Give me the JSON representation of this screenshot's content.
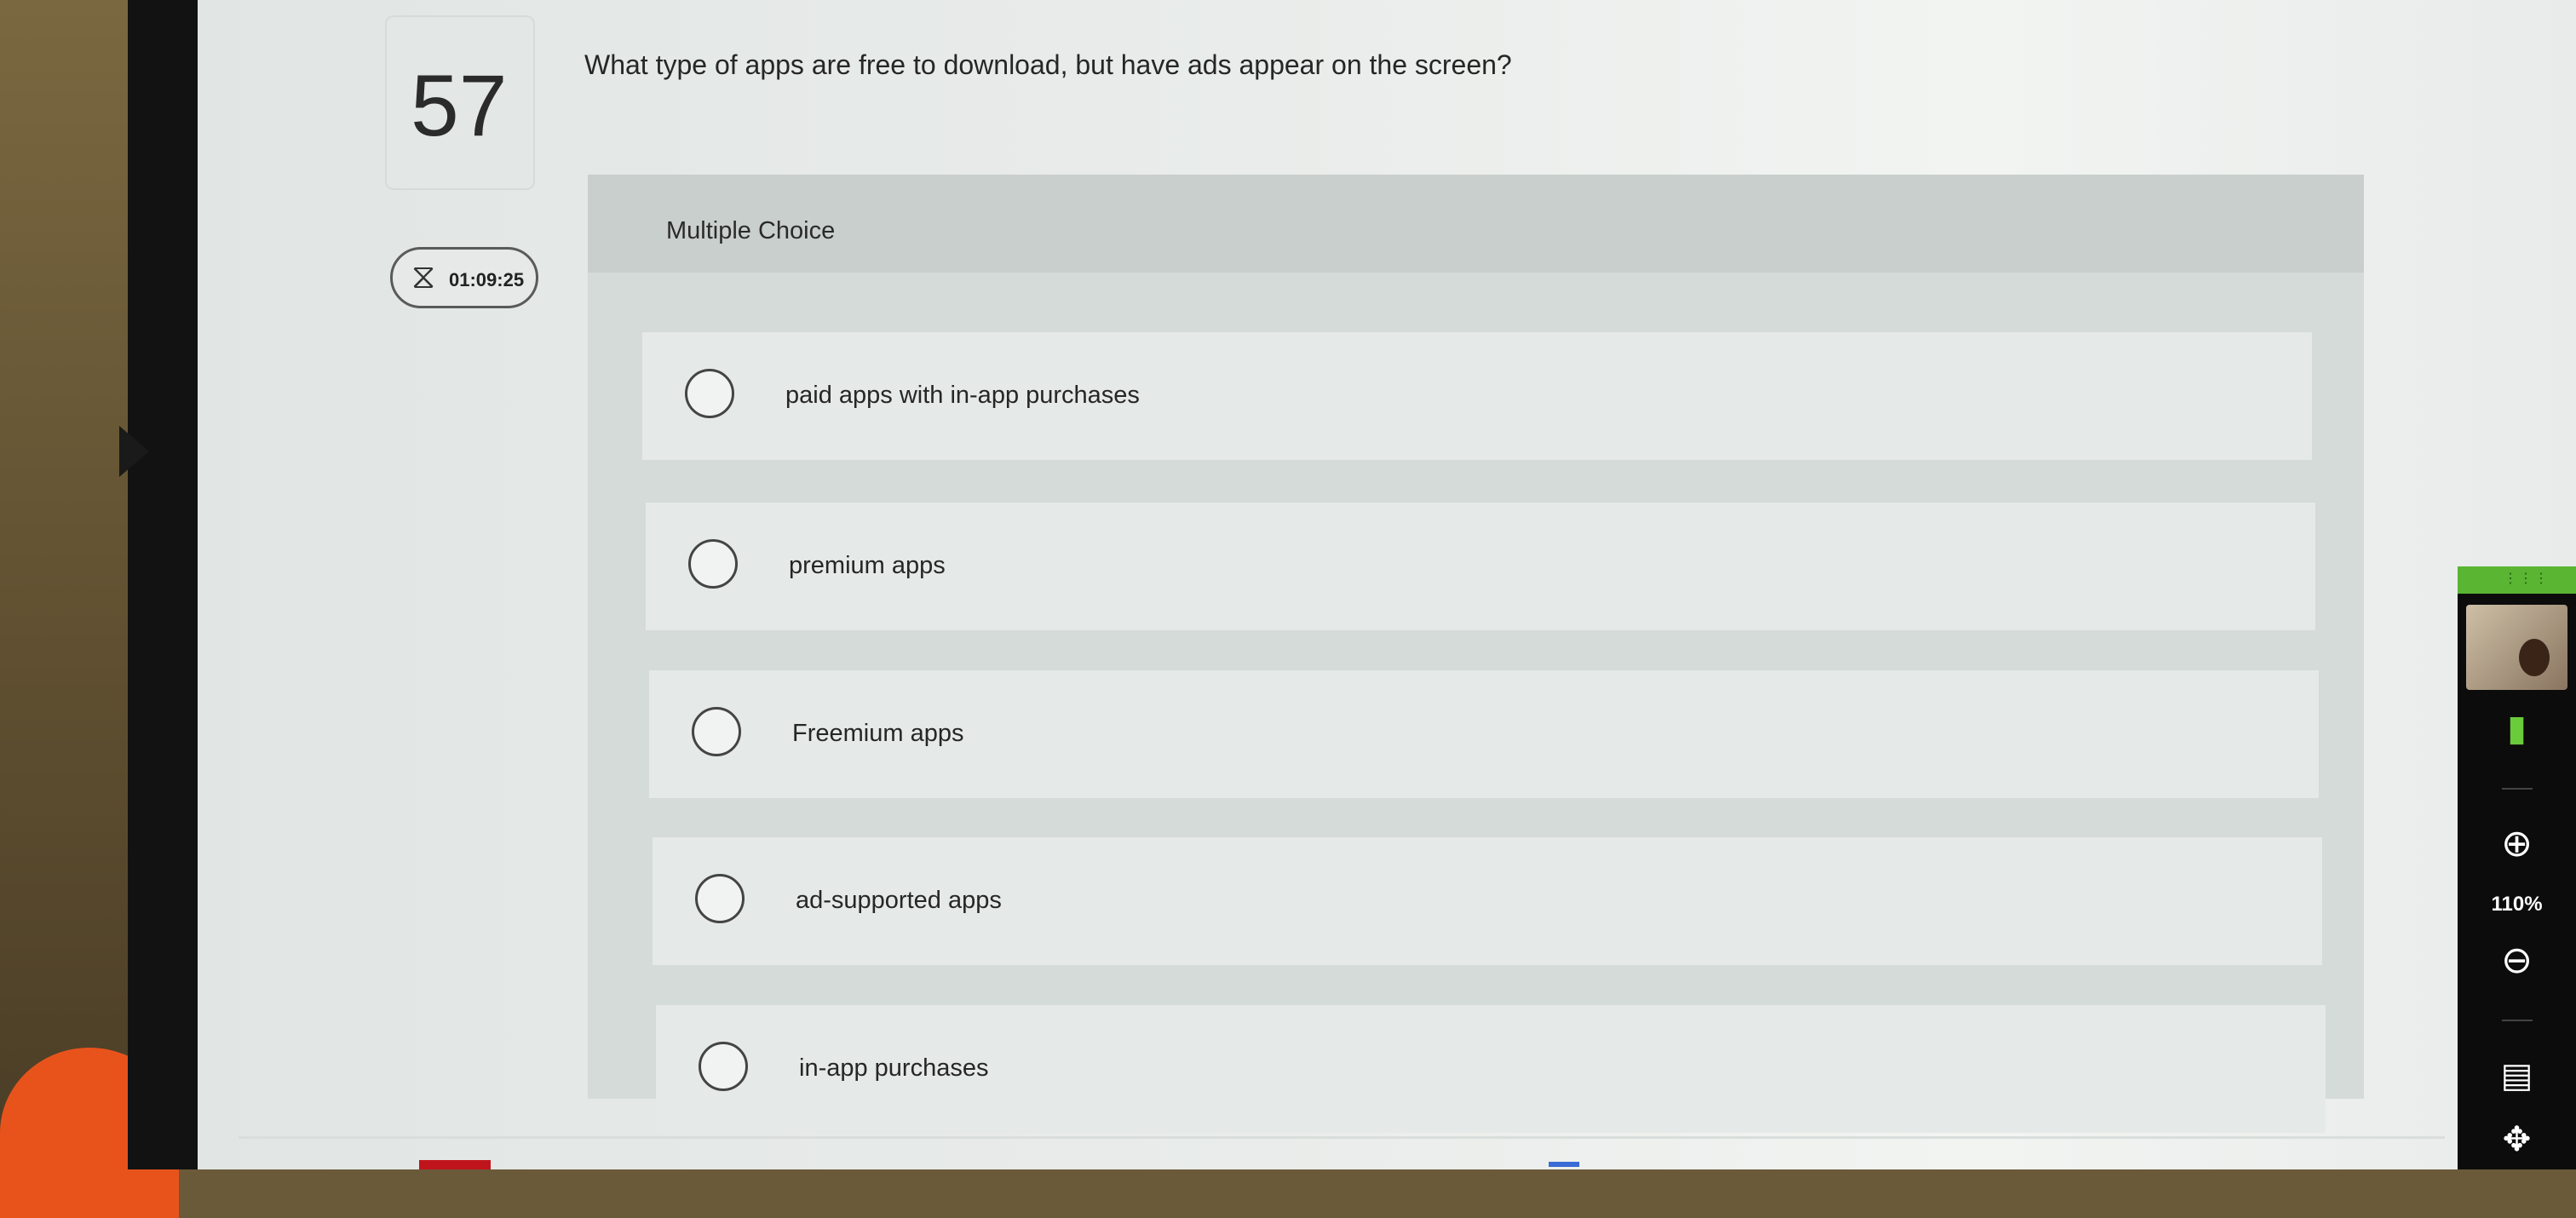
{
  "question": {
    "number": "57",
    "text": "What type of apps are free to download, but have ads appear on the screen?",
    "timer": "01:09:25",
    "type_label": "Multiple Choice"
  },
  "options": [
    {
      "label": "paid apps with in-app purchases"
    },
    {
      "label": "premium apps"
    },
    {
      "label": "Freemium apps"
    },
    {
      "label": "ad-supported apps"
    },
    {
      "label": "in-app purchases"
    }
  ],
  "toolbar": {
    "zoom": "110%",
    "icons": [
      "grip-icon",
      "battery-icon",
      "zoom-in-icon",
      "zoom-out-icon",
      "comment-icon",
      "move-icon"
    ],
    "accent": "#5ab532"
  }
}
